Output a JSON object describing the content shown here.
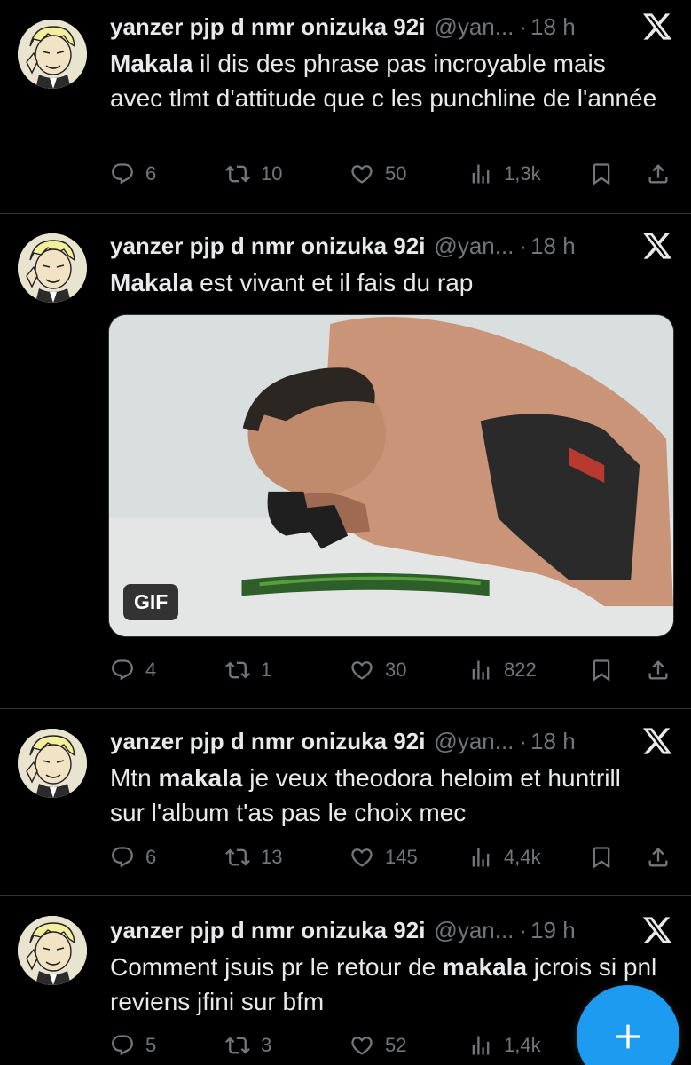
{
  "tweets": [
    {
      "name": "yanzer pjp d nmr onizuka 92i",
      "handle": "@yan...",
      "time": "18 h",
      "text_parts": [
        {
          "bold": "Makala"
        },
        {
          "plain": " il dis des phrase pas incroyable mais avec tlmt d'attitude que c les punchline de l'année"
        }
      ],
      "replies": "6",
      "retweets": "10",
      "likes": "50",
      "views": "1,3k"
    },
    {
      "name": "yanzer pjp d nmr onizuka 92i",
      "handle": "@yan...",
      "time": "18 h",
      "text_parts": [
        {
          "bold": "Makala"
        },
        {
          "plain": " est vivant et il fais du rap"
        }
      ],
      "media_badge": "GIF",
      "replies": "4",
      "retweets": "1",
      "likes": "30",
      "views": "822"
    },
    {
      "name": "yanzer pjp d nmr onizuka 92i",
      "handle": "@yan...",
      "time": "18 h",
      "text_parts": [
        {
          "plain": "Mtn "
        },
        {
          "bold": "makala"
        },
        {
          "plain": " je veux theodora heloim et huntrill sur l'album t'as pas le choix mec"
        }
      ],
      "replies": "6",
      "retweets": "13",
      "likes": "145",
      "views": "4,4k"
    },
    {
      "name": "yanzer pjp d nmr onizuka 92i",
      "handle": "@yan...",
      "time": "19 h",
      "text_parts": [
        {
          "plain": "Comment jsuis pr le retour de "
        },
        {
          "bold": "makala"
        },
        {
          "plain": " jcrois si pnl reviens jfini sur bfm"
        }
      ],
      "replies": "5",
      "retweets": "3",
      "likes": "52",
      "views": "1,4k"
    }
  ],
  "separator": "·",
  "colors": {
    "background": "#000000",
    "text": "#e7e9ea",
    "muted": "#71767b",
    "divider": "#2f3336",
    "accent": "#1d9bf0"
  },
  "icons": [
    "reply-icon",
    "retweet-icon",
    "like-icon",
    "views-icon",
    "bookmark-icon",
    "share-icon",
    "x-logo-icon",
    "compose-plus-icon"
  ]
}
